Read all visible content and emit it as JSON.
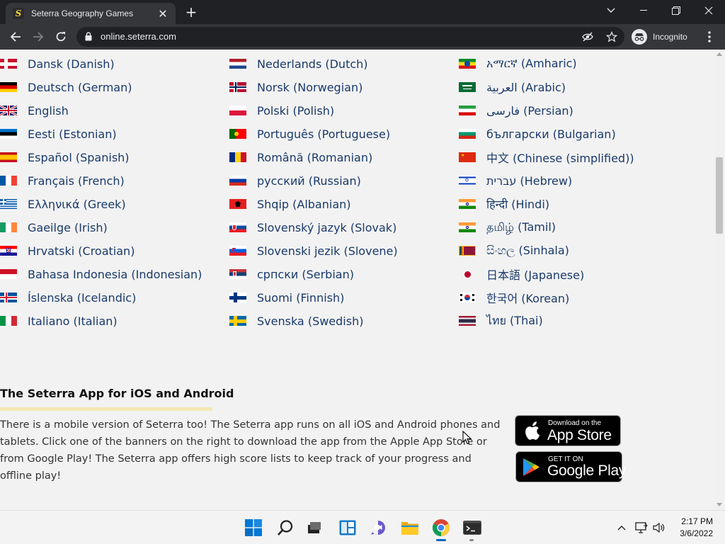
{
  "browser": {
    "tab_title": "Seterra Geography Games",
    "tab_close": "✕",
    "new_tab": "+",
    "url": "online.seterra.com",
    "incognito_label": "Incognito"
  },
  "languages": {
    "col1": [
      {
        "label": "Dansk (Danish)",
        "flag": "dk"
      },
      {
        "label": "Deutsch (German)",
        "flag": "de"
      },
      {
        "label": "English",
        "flag": "gb"
      },
      {
        "label": "Eesti (Estonian)",
        "flag": "ee"
      },
      {
        "label": "Español (Spanish)",
        "flag": "es"
      },
      {
        "label": "Français (French)",
        "flag": "fr"
      },
      {
        "label": "Ελληνικά (Greek)",
        "flag": "gr"
      },
      {
        "label": "Gaeilge (Irish)",
        "flag": "ie"
      },
      {
        "label": "Hrvatski (Croatian)",
        "flag": "hr"
      },
      {
        "label": "Bahasa Indonesia (Indonesian)",
        "flag": "id"
      },
      {
        "label": "Íslenska (Icelandic)",
        "flag": "is"
      },
      {
        "label": "Italiano (Italian)",
        "flag": "it"
      }
    ],
    "col2": [
      {
        "label": "Nederlands (Dutch)",
        "flag": "nl"
      },
      {
        "label": "Norsk (Norwegian)",
        "flag": "no"
      },
      {
        "label": "Polski (Polish)",
        "flag": "pl"
      },
      {
        "label": "Português (Portuguese)",
        "flag": "pt"
      },
      {
        "label": "Română (Romanian)",
        "flag": "ro"
      },
      {
        "label": "русский (Russian)",
        "flag": "ru"
      },
      {
        "label": "Shqip (Albanian)",
        "flag": "al"
      },
      {
        "label": "Slovenský jazyk (Slovak)",
        "flag": "sk"
      },
      {
        "label": "Slovenski jezik (Slovene)",
        "flag": "si"
      },
      {
        "label": "српски (Serbian)",
        "flag": "rs"
      },
      {
        "label": "Suomi (Finnish)",
        "flag": "fi"
      },
      {
        "label": "Svenska (Swedish)",
        "flag": "se"
      }
    ],
    "col3": [
      {
        "label": "አማርኛ (Amharic)",
        "flag": "et"
      },
      {
        "label": "العربية (Arabic)",
        "flag": "sa"
      },
      {
        "label": "فارسی (Persian)",
        "flag": "ir"
      },
      {
        "label": "български (Bulgarian)",
        "flag": "bg"
      },
      {
        "label": "中文 (Chinese (simplified))",
        "flag": "cn"
      },
      {
        "label": "עברית (Hebrew)",
        "flag": "il"
      },
      {
        "label": "हिन्दी (Hindi)",
        "flag": "in"
      },
      {
        "label": "தமிழ் (Tamil)",
        "flag": "in"
      },
      {
        "label": "සිංහල (Sinhala)",
        "flag": "lk"
      },
      {
        "label": "日本語 (Japanese)",
        "flag": "jp"
      },
      {
        "label": "한국어 (Korean)",
        "flag": "kr"
      },
      {
        "label": "ไทย (Thai)",
        "flag": "th"
      }
    ]
  },
  "app_section": {
    "title": "The Seterra App for iOS and Android",
    "description": "There is a mobile version of Seterra too! The Seterra app runs on all iOS and Android phones and tablets. Click one of the banners on the right to download the app from the Apple App Store or from Google Play! The Seterra app offers high score lists to keep track of your progress and offline play!",
    "appstore_small": "Download on the",
    "appstore_big": "App Store",
    "googleplay_small": "GET IT ON",
    "googleplay_big": "Google Play"
  },
  "taskbar": {
    "time": "2:17 PM",
    "date": "3/6/2022"
  },
  "colors": {
    "link": "#1a3a6b",
    "chrome_dark": "#202124",
    "chrome_toolbar": "#35363a",
    "page_bg": "#f2f2f2",
    "underline": "#f3e8b2"
  }
}
